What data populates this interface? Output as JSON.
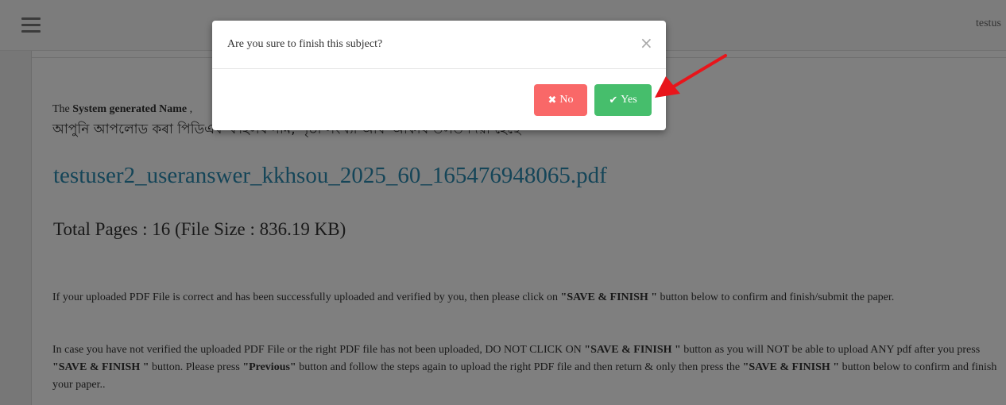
{
  "header": {
    "user": "testus"
  },
  "page": {
    "system_note_bold": "System generated Name",
    "system_note_prefix": "The ",
    "system_note_suffix": " ,",
    "bengali_note": "আপুনি আপলোড কৰা পিডিএফ ফাইলৰ নাম, পৃষ্ঠা সংখ্যা আৰু আকাৰ তলত দিয়া হৈছে",
    "file_name": "testuser2_useranswer_kkhsou_2025_60_165476948065.pdf",
    "pages_info": "Total Pages : 16 (File Size : 836.19 KB)",
    "para1_a": "If your uploaded PDF File is correct and has been successfully uploaded and verified by you, then please click on ",
    "para1_b": "\"SAVE & FINISH \"",
    "para1_c": " button below to confirm and finish/submit the paper.",
    "para2_a": "In case you have not verified the uploaded PDF File or the right PDF file has not been uploaded, DO NOT CLICK ON ",
    "para2_b": "\"SAVE & FINISH \"",
    "para2_c": " button as you will NOT be able to upload ANY pdf after you press ",
    "para2_d": "\"SAVE & FINISH \"",
    "para2_e": " button. Please press ",
    "para2_f": "\"Previous\"",
    "para2_g": " button and follow the steps again to upload the right PDF file and then return & only then press the ",
    "para2_h": "\"SAVE & FINISH \"",
    "para2_i": " button below to confirm and finish your paper.."
  },
  "modal": {
    "title": "Are you sure to finish this subject?",
    "close_symbol": "×",
    "no_icon": "✖",
    "no_label": "No",
    "yes_icon": "✔",
    "yes_label": "Yes"
  },
  "icons": {
    "menu": "hamburger-icon",
    "close": "close-icon",
    "no": "times-icon",
    "yes": "check-icon",
    "annotation": "red-arrow"
  },
  "colors": {
    "no_button": "#f96868",
    "yes_button": "#46be6c",
    "link": "#2a8ab0",
    "arrow": "#e8151b"
  }
}
